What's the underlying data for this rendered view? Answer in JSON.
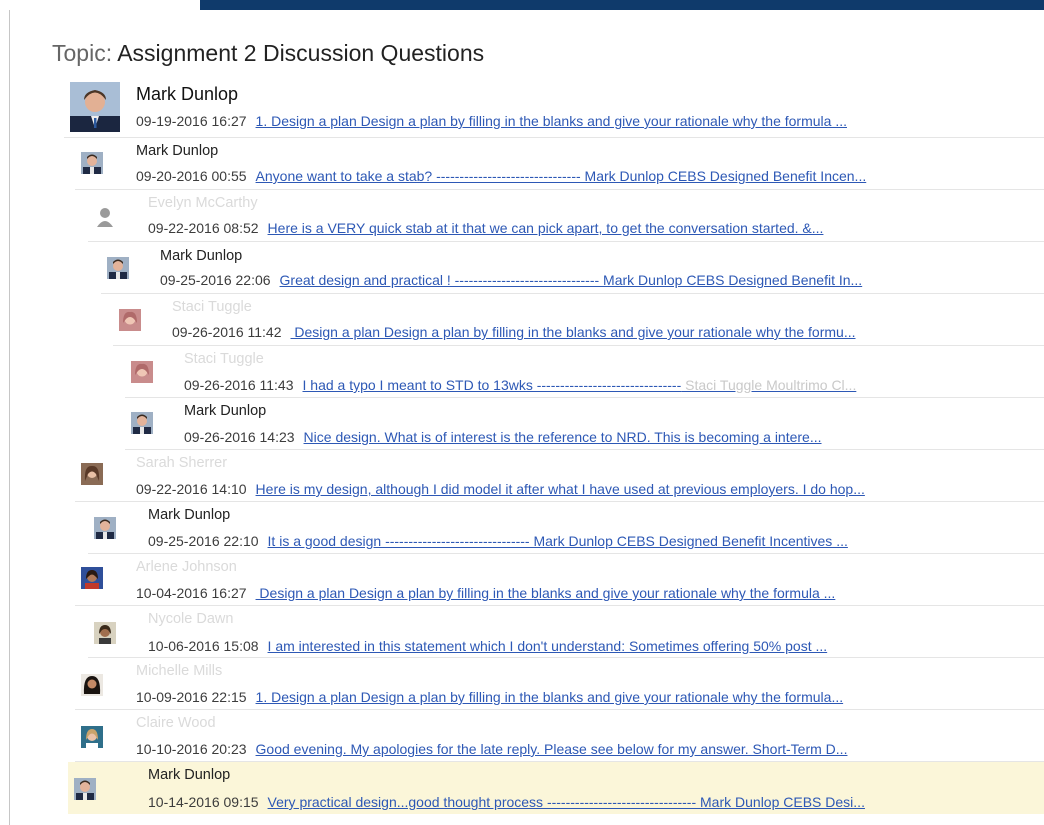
{
  "topic": {
    "prefix": "Topic:",
    "title": "Assignment 2 Discussion Questions"
  },
  "posts": [
    {
      "author": "Mark Dunlop",
      "date": "09-19-2016 16:27",
      "link": "1. Design a plan Design a plan by filling in the blanks and give your rationale why the formula ...",
      "avatar": "man-suit"
    },
    {
      "author": "Mark Dunlop",
      "date": "09-20-2016 00:55",
      "link": "Anyone want to take a stab? ------------------------------- Mark Dunlop CEBS Designed Benefit Incen...",
      "avatar": "man-suit"
    },
    {
      "author": "Evelyn McCarthy",
      "date": "09-22-2016 08:52",
      "link": "Here is a VERY quick stab at it that we can pick apart, to get the conversation started. &...",
      "avatar": "placeholder"
    },
    {
      "author": "Mark Dunlop",
      "date": "09-25-2016 22:06",
      "link": "Great design and practical ! ------------------------------- Mark Dunlop CEBS Designed Benefit In...",
      "avatar": "man-suit"
    },
    {
      "author": "Staci Tuggle",
      "date": "09-26-2016 11:42",
      "link": " Design a plan Design a plan by filling in the blanks and give your rationale why the formu...",
      "avatar": "woman-pink"
    },
    {
      "author": "Staci Tuggle",
      "date": "09-26-2016 11:43",
      "link": "I had a typo I meant to STD to 13wks -------------------------------",
      "link_faint": " Staci Tuggle Moultrimo Cl...",
      "avatar": "woman-pink"
    },
    {
      "author": "Mark Dunlop",
      "date": "09-26-2016 14:23",
      "link": "Nice design. What is of interest is the reference to NRD. This is becoming a intere...",
      "avatar": "man-suit"
    },
    {
      "author": "Sarah Sherrer",
      "date": "09-22-2016 14:10",
      "link": "Here is my design, although I did model it after what I have used at previous employers. I do hop...",
      "avatar": "woman-brown"
    },
    {
      "author": "Mark Dunlop",
      "date": "09-25-2016 22:10",
      "link": "It is a good design ------------------------------- Mark Dunlop CEBS Designed Benefit Incentives ...",
      "avatar": "man-suit"
    },
    {
      "author": "Arlene Johnson",
      "date": "10-04-2016 16:27",
      "link": " Design a plan Design a plan by filling in the blanks and give your rationale why the formula ...",
      "avatar": "woman-blue"
    },
    {
      "author": "Nycole Dawn",
      "date": "10-06-2016 15:08",
      "link": "I am interested in this statement which I don't understand: Sometimes offering 50% post ...",
      "avatar": "woman-dark"
    },
    {
      "author": "Michelle Mills",
      "date": "10-09-2016 22:15",
      "link": "1. Design a plan Design a plan by filling in the blanks and give your rationale why the formula...",
      "avatar": "woman-black"
    },
    {
      "author": "Claire Wood",
      "date": "10-10-2016 20:23",
      "link": "Good evening. My apologies for the late reply. Please see below for my answer. Short-Term D...",
      "avatar": "woman-teal"
    },
    {
      "author": "Mark Dunlop",
      "date": "10-14-2016 09:15",
      "link": "Very practical design...good thought process -------------------------------- Mark Dunlop CEBS Desi...",
      "avatar": "man-suit"
    }
  ]
}
